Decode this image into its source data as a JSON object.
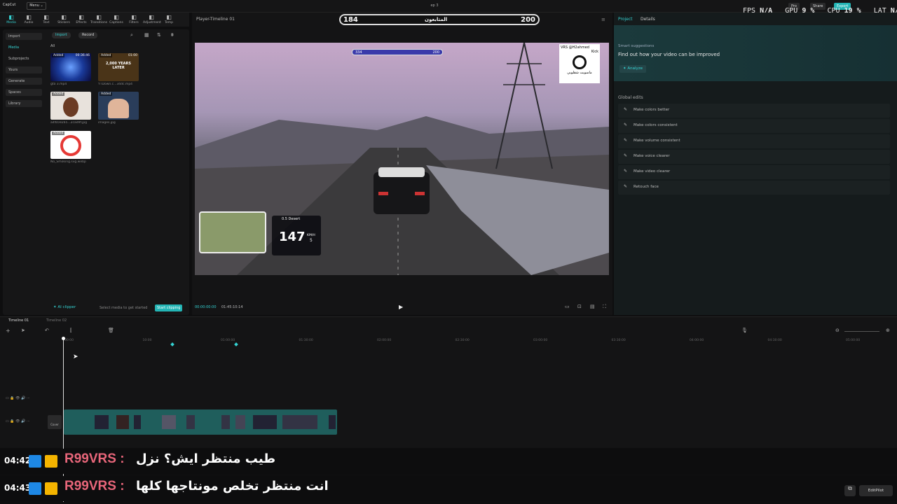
{
  "app": {
    "logo": "CapCut",
    "menu_label": "Menu ⌄",
    "project_name": "ep 3",
    "pro_label": "Pro",
    "share_label": "Share",
    "export_label": "Export"
  },
  "stats": {
    "fps_label": "FPS",
    "fps": "N/A",
    "gpu_label": "GPU",
    "gpu": "9 %",
    "cpu_label": "CPU",
    "cpu": "19 %",
    "lat_label": "LAT",
    "lat": "N/A"
  },
  "tools": [
    {
      "label": "Media",
      "icon": "media-icon"
    },
    {
      "label": "Audio",
      "icon": "audio-icon"
    },
    {
      "label": "Text",
      "icon": "text-icon"
    },
    {
      "label": "Stickers",
      "icon": "stickers-icon"
    },
    {
      "label": "Effects",
      "icon": "effects-icon"
    },
    {
      "label": "Transitions",
      "icon": "transitions-icon"
    },
    {
      "label": "Captions",
      "icon": "captions-icon"
    },
    {
      "label": "Filters",
      "icon": "filters-icon"
    },
    {
      "label": "Adjustment",
      "icon": "adjustment-icon"
    },
    {
      "label": "Temp",
      "icon": "templates-icon"
    }
  ],
  "sidebar": {
    "import": "Import",
    "media": "Media",
    "subprojects": "Subprojects",
    "yours": "Yours",
    "generate": "Generate",
    "spaces": "Spaces",
    "library": "Library"
  },
  "media": {
    "import_btn": "Import",
    "record_btn": "Record",
    "filter_all": "All",
    "items": [
      {
        "name": "gta 3.mp4",
        "badge": "Added",
        "duration": "00:36:46"
      },
      {
        "name": "YTDown.c...34dc.mp4",
        "badge": "Added",
        "duration": "01:00",
        "overlay": "2,000 YEARS LATER"
      },
      {
        "name": "a4fb59265...2cad9f.jpg",
        "badge": "Added",
        "duration": ""
      },
      {
        "name": "images.jpg",
        "badge": "Added",
        "duration": ""
      },
      {
        "name": "No_Smoking.svg.webp",
        "badge": "Added",
        "duration": ""
      }
    ],
    "ai_clipper": "AI clipper",
    "hint": "Select media to get started",
    "start_clipping": "Start clipping"
  },
  "player": {
    "title": "Player-Timeline 01",
    "time_current": "00:00:00:00",
    "time_total": "01:45:10:14"
  },
  "hud": {
    "left": "184",
    "center": "المتابعون",
    "right": "200",
    "inner_left": "334",
    "inner_right": "200",
    "speed": "147",
    "speed_unit": "KM/H",
    "gear": "5",
    "location": "0.5 Desert",
    "overlay_top": "VRS @H2ahmed",
    "overlay_kick": "Kick",
    "overlay_ar": "ماسويت شقلوبي"
  },
  "rightpanel": {
    "tab_project": "Project",
    "tab_details": "Details",
    "suggest_title": "Smart suggestions",
    "suggest_text": "Find out how your video can be improved",
    "analyze": "Analyze",
    "global_edits": "Global edits",
    "edits": [
      {
        "label": "Make colors better",
        "icon": "wand-icon"
      },
      {
        "label": "Make colors consistent",
        "icon": "palette-icon"
      },
      {
        "label": "Make volume consistent",
        "icon": "sliders-icon"
      },
      {
        "label": "Make voice clearer",
        "icon": "voice-icon"
      },
      {
        "label": "Make video clearer",
        "icon": "hd-icon"
      },
      {
        "label": "Retouch face",
        "icon": "face-icon"
      }
    ]
  },
  "timeline": {
    "tab1": "Timeline 01",
    "tab2": "Timeline 02",
    "cover": "Cover",
    "ticks": [
      "00:00",
      "10:00",
      "01:00:00",
      "01:30:00",
      "02:00:00",
      "02:30:00",
      "03:00:00",
      "03:30:00",
      "04:00:00",
      "04:30:00",
      "05:00:00"
    ]
  },
  "chat": [
    {
      "time": "04:42",
      "name": "R99VRS :",
      "msg": "طيب منتظر ايش؟ نزل"
    },
    {
      "time": "04:43",
      "name": "R99VRS :",
      "msg": "انت منتظر تخلص مونتاجها كلها"
    }
  ],
  "editpilot": "EditPilot",
  "colors": {
    "accent": "#35d3d3",
    "chat_name": "#e8667a",
    "chip_blue": "#1e88e5",
    "chip_gold": "#f4b400"
  }
}
